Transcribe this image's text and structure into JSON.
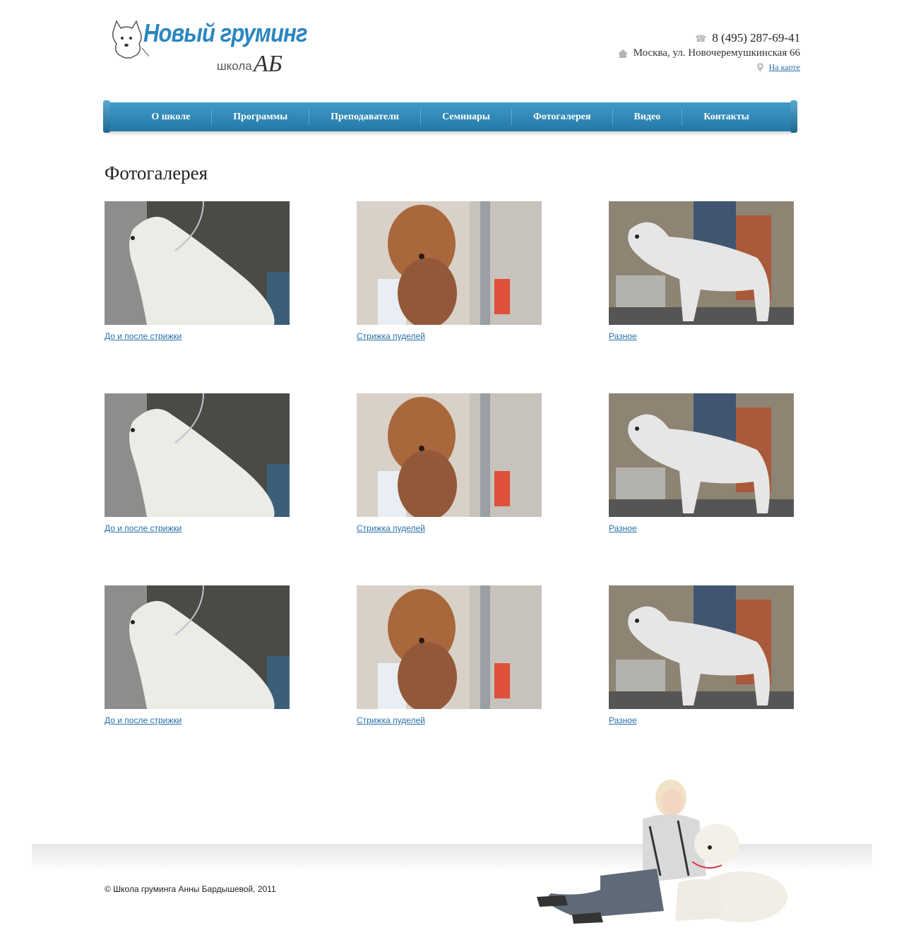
{
  "header": {
    "logo": {
      "title": "Новый груминг",
      "subtitle": "школа",
      "monogram": "АБ"
    },
    "contacts": {
      "phone": "8 (495) 287-69-41",
      "address": "Москва, ул. Новочеремушкинская 66",
      "map_link": "На карте"
    }
  },
  "nav": {
    "items": [
      {
        "label": "О школе"
      },
      {
        "label": "Программы"
      },
      {
        "label": "Преподаватели"
      },
      {
        "label": "Семинары"
      },
      {
        "label": "Фотогалерея"
      },
      {
        "label": "Видео"
      },
      {
        "label": "Контакты"
      }
    ]
  },
  "page": {
    "title": "Фотогалерея"
  },
  "gallery": {
    "rows": [
      [
        {
          "caption": "До и после стрижки",
          "photo": "west-highland-terrier"
        },
        {
          "caption": "Стрижка пуделей",
          "photo": "brown-poodle"
        },
        {
          "caption": "Разное",
          "photo": "white-schnauzer"
        }
      ],
      [
        {
          "caption": "До и после стрижки",
          "photo": "west-highland-terrier"
        },
        {
          "caption": "Стрижка пуделей",
          "photo": "brown-poodle"
        },
        {
          "caption": "Разное",
          "photo": "white-schnauzer"
        }
      ],
      [
        {
          "caption": "До и после стрижки",
          "photo": "west-highland-terrier"
        },
        {
          "caption": "Стрижка пуделей",
          "photo": "brown-poodle"
        },
        {
          "caption": "Разное",
          "photo": "white-schnauzer"
        }
      ]
    ]
  },
  "footer": {
    "copyright": "© Школа груминга Анны Бардышевой, 2011"
  },
  "icons": {
    "phone": "phone-icon",
    "address": "home-icon",
    "map": "map-pin-icon"
  },
  "colors": {
    "nav_top": "#3f9ac6",
    "nav_bottom": "#2578a8",
    "link": "#2a6fa8",
    "logo_blue": "#2a86bf"
  }
}
